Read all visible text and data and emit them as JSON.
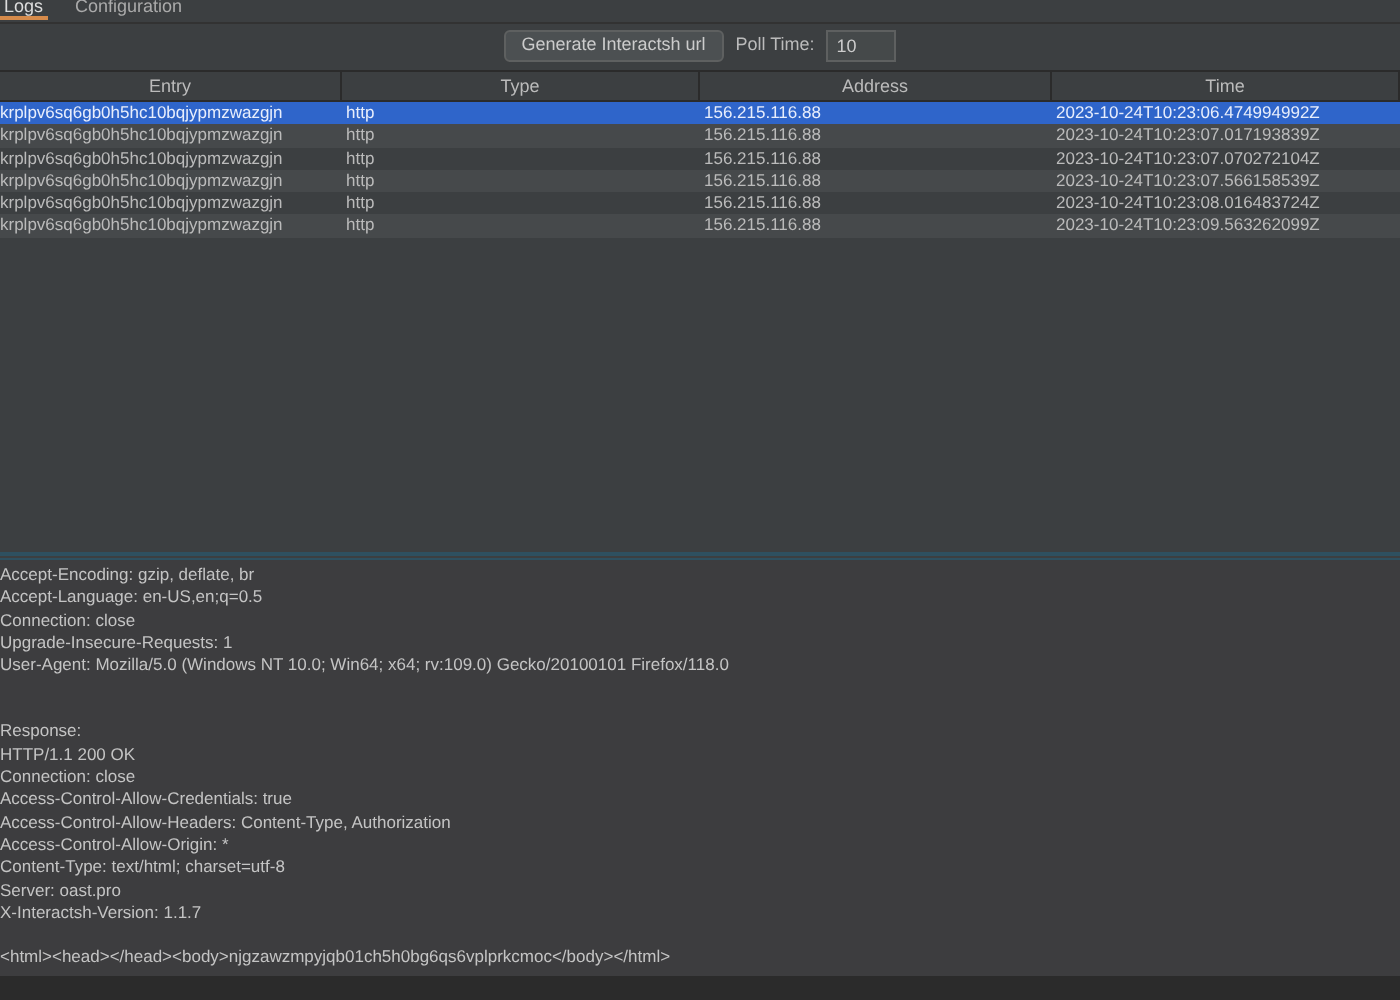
{
  "tabs": [
    {
      "label": "Logs",
      "selected": true
    },
    {
      "label": "Configuration",
      "selected": false
    }
  ],
  "toolbar": {
    "generate_button": "Generate Interactsh url",
    "poll_label": "Poll Time:",
    "poll_value": "10"
  },
  "table": {
    "columns": [
      "Entry",
      "Type",
      "Address",
      "Time"
    ],
    "rows": [
      {
        "cells": [
          "krplpv6sq6gb0h5hc10bqjypmzwazgjn",
          "http",
          "156.215.116.88",
          "2023-10-24T10:23:06.474994992Z"
        ],
        "selected": true
      },
      {
        "cells": [
          "krplpv6sq6gb0h5hc10bqjypmzwazgjn",
          "http",
          "156.215.116.88",
          "2023-10-24T10:23:07.017193839Z"
        ],
        "selected": false
      },
      {
        "cells": [
          "krplpv6sq6gb0h5hc10bqjypmzwazgjn",
          "http",
          "156.215.116.88",
          "2023-10-24T10:23:07.070272104Z"
        ],
        "selected": false
      },
      {
        "cells": [
          "krplpv6sq6gb0h5hc10bqjypmzwazgjn",
          "http",
          "156.215.116.88",
          "2023-10-24T10:23:07.566158539Z"
        ],
        "selected": false
      },
      {
        "cells": [
          "krplpv6sq6gb0h5hc10bqjypmzwazgjn",
          "http",
          "156.215.116.88",
          "2023-10-24T10:23:08.016483724Z"
        ],
        "selected": false
      },
      {
        "cells": [
          "krplpv6sq6gb0h5hc10bqjypmzwazgjn",
          "http",
          "156.215.116.88",
          "2023-10-24T10:23:09.563262099Z"
        ],
        "selected": false
      }
    ]
  },
  "detail": {
    "request_lines": [
      "Accept-Encoding: gzip, deflate, br",
      "Accept-Language: en-US,en;q=0.5",
      "Connection: close",
      "Upgrade-Insecure-Requests: 1",
      "User-Agent: Mozilla/5.0 (Windows NT 10.0; Win64; x64; rv:109.0) Gecko/20100101 Firefox/118.0"
    ],
    "response_lines": [
      "Response:",
      "HTTP/1.1 200 OK",
      "Connection: close",
      "Access-Control-Allow-Credentials: true",
      "Access-Control-Allow-Headers: Content-Type, Authorization",
      "Access-Control-Allow-Origin: *",
      "Content-Type: text/html; charset=utf-8",
      "Server: oast.pro",
      "X-Interactsh-Version: 1.1.7"
    ],
    "body": "<html><head></head><body>njgzawzmpyjqb01ch5h0bg6qs6vplprkcmoc</body></html>"
  }
}
